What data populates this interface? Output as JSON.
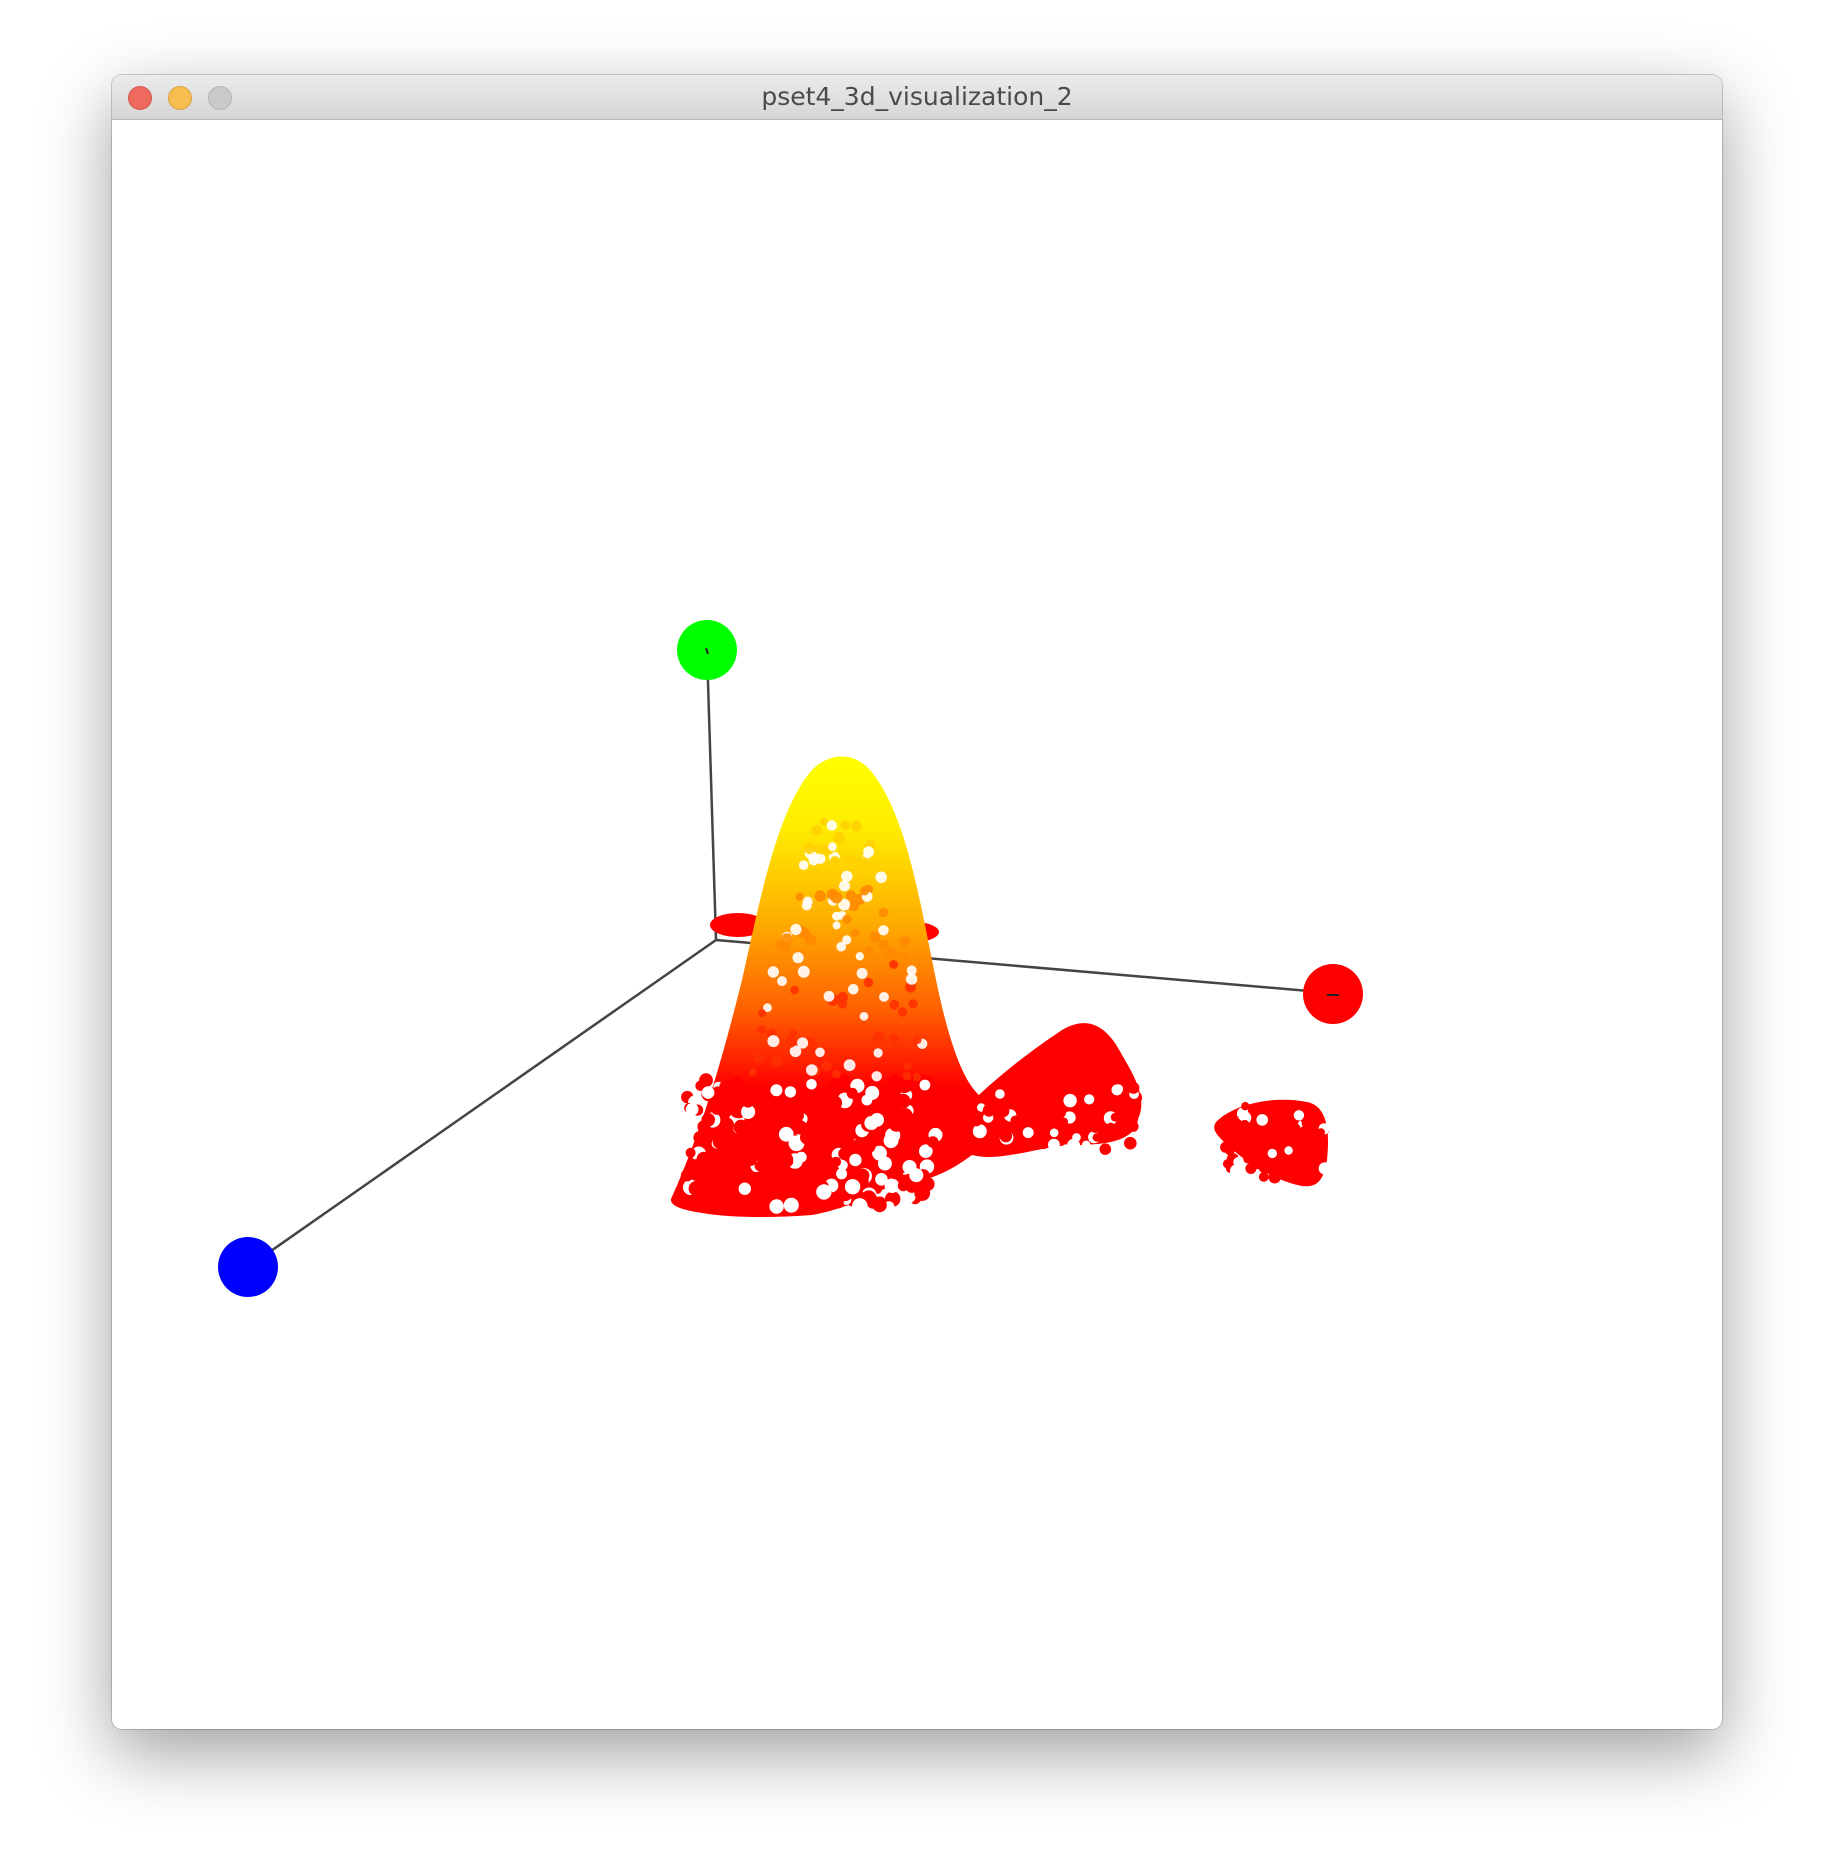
{
  "window": {
    "title": "pset4_3d_visualization_2"
  },
  "scene": {
    "background": "#ffffff",
    "axis_line_color": "#444444",
    "axis_markers": [
      {
        "axis": "x",
        "color": "#ff0000"
      },
      {
        "axis": "y",
        "color": "#00ff00"
      },
      {
        "axis": "z",
        "color": "#0000ff"
      }
    ],
    "surface_colormap": [
      "#ff0000",
      "#ff8800",
      "#ffff00"
    ]
  }
}
